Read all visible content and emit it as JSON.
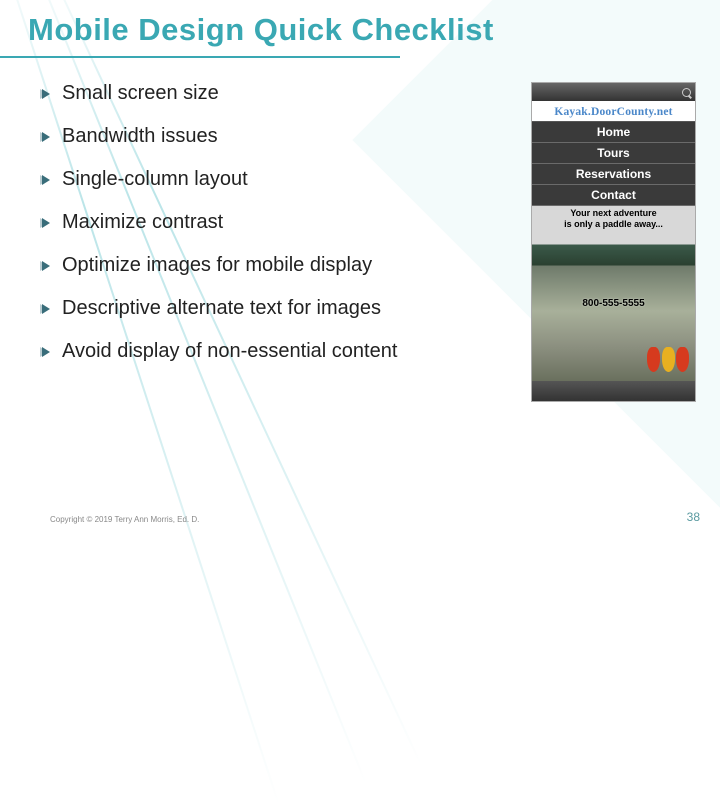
{
  "title": "Mobile Design Quick Checklist",
  "bullets": [
    "Small screen size",
    "Bandwidth issues",
    "Single-column layout",
    "Maximize contrast",
    "Optimize images for mobile display",
    "Descriptive alternate text for images",
    "Avoid display of non-essential content"
  ],
  "mockup": {
    "logo": "Kayak.DoorCounty.net",
    "nav": [
      "Home",
      "Tours",
      "Reservations",
      "Contact"
    ],
    "tagline_line1": "Your next adventure",
    "tagline_line2": "is only a paddle away...",
    "phone": "800-555-5555"
  },
  "footer": "Copyright © 2019 Terry Ann Morris, Ed. D.",
  "page_number": "38"
}
